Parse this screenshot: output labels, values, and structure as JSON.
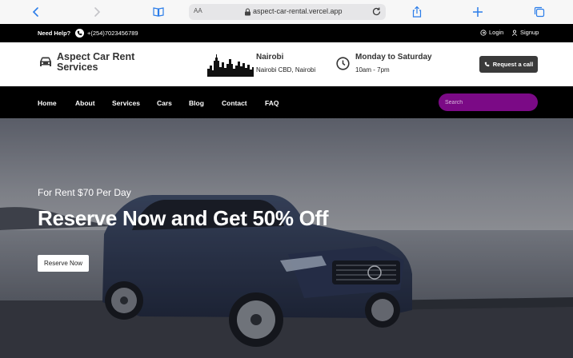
{
  "browser": {
    "text_size_label": "AA",
    "url": "aspect-car-rental.vercel.app",
    "icons": [
      "back-icon",
      "forward-icon",
      "book-icon",
      "lock-icon",
      "reload-icon",
      "share-icon",
      "new-tab-icon",
      "tabs-icon"
    ]
  },
  "topbar": {
    "help_label": "Need Help?",
    "phone": "+(254)7023456789",
    "login_label": "Login",
    "signup_label": "Signup"
  },
  "header": {
    "brand": "Aspect Car Rent Services",
    "city": "Nairobi",
    "location": "Nairobi CBD, Nairobi",
    "days": "Monday to Saturday",
    "hours": "10am - 7pm",
    "call_button_label": "Request a call"
  },
  "nav": {
    "items": [
      "Home",
      "About",
      "Services",
      "Cars",
      "Blog",
      "Contact",
      "FAQ"
    ],
    "search_placeholder": "Search"
  },
  "hero": {
    "tagline": "For Rent $70 Per Day",
    "headline": "Reserve Now and Get 50% Off",
    "cta_label": "Reserve Now"
  },
  "colors": {
    "accent": "#7b0a86",
    "dark": "#000000",
    "button_dark": "#3a3a3a",
    "browser_blue": "#2b7de9"
  }
}
